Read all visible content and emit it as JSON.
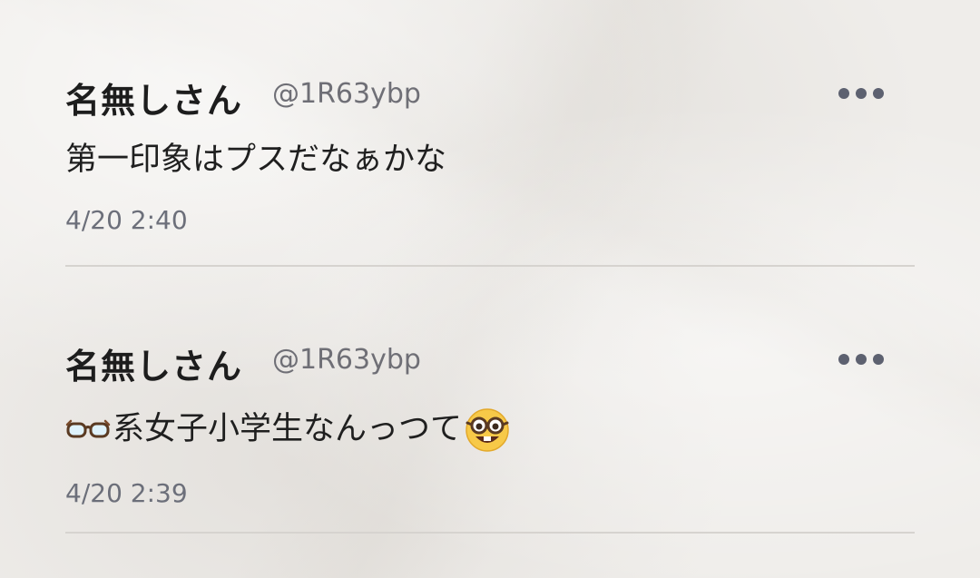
{
  "posts": [
    {
      "author": "名無しさん",
      "handle": "@1R63ybp",
      "body": "第一印象はプスだなぁかな",
      "time": "4/20 2:40",
      "menu_icon": "more-horizontal-icon"
    },
    {
      "author": "名無しさん",
      "handle": "@1R63ybp",
      "body": "系女子小学生なんっつて",
      "time": "4/20 2:39",
      "menu_icon": "more-horizontal-icon",
      "leading_emoji": "glasses-icon",
      "trailing_emoji": "nerd-face-icon"
    }
  ],
  "colors": {
    "background": "#efedea",
    "text": "#1f1f1f",
    "muted": "#6c6f7a",
    "dots": "#5d6170",
    "divider": "#d6d3cf"
  }
}
